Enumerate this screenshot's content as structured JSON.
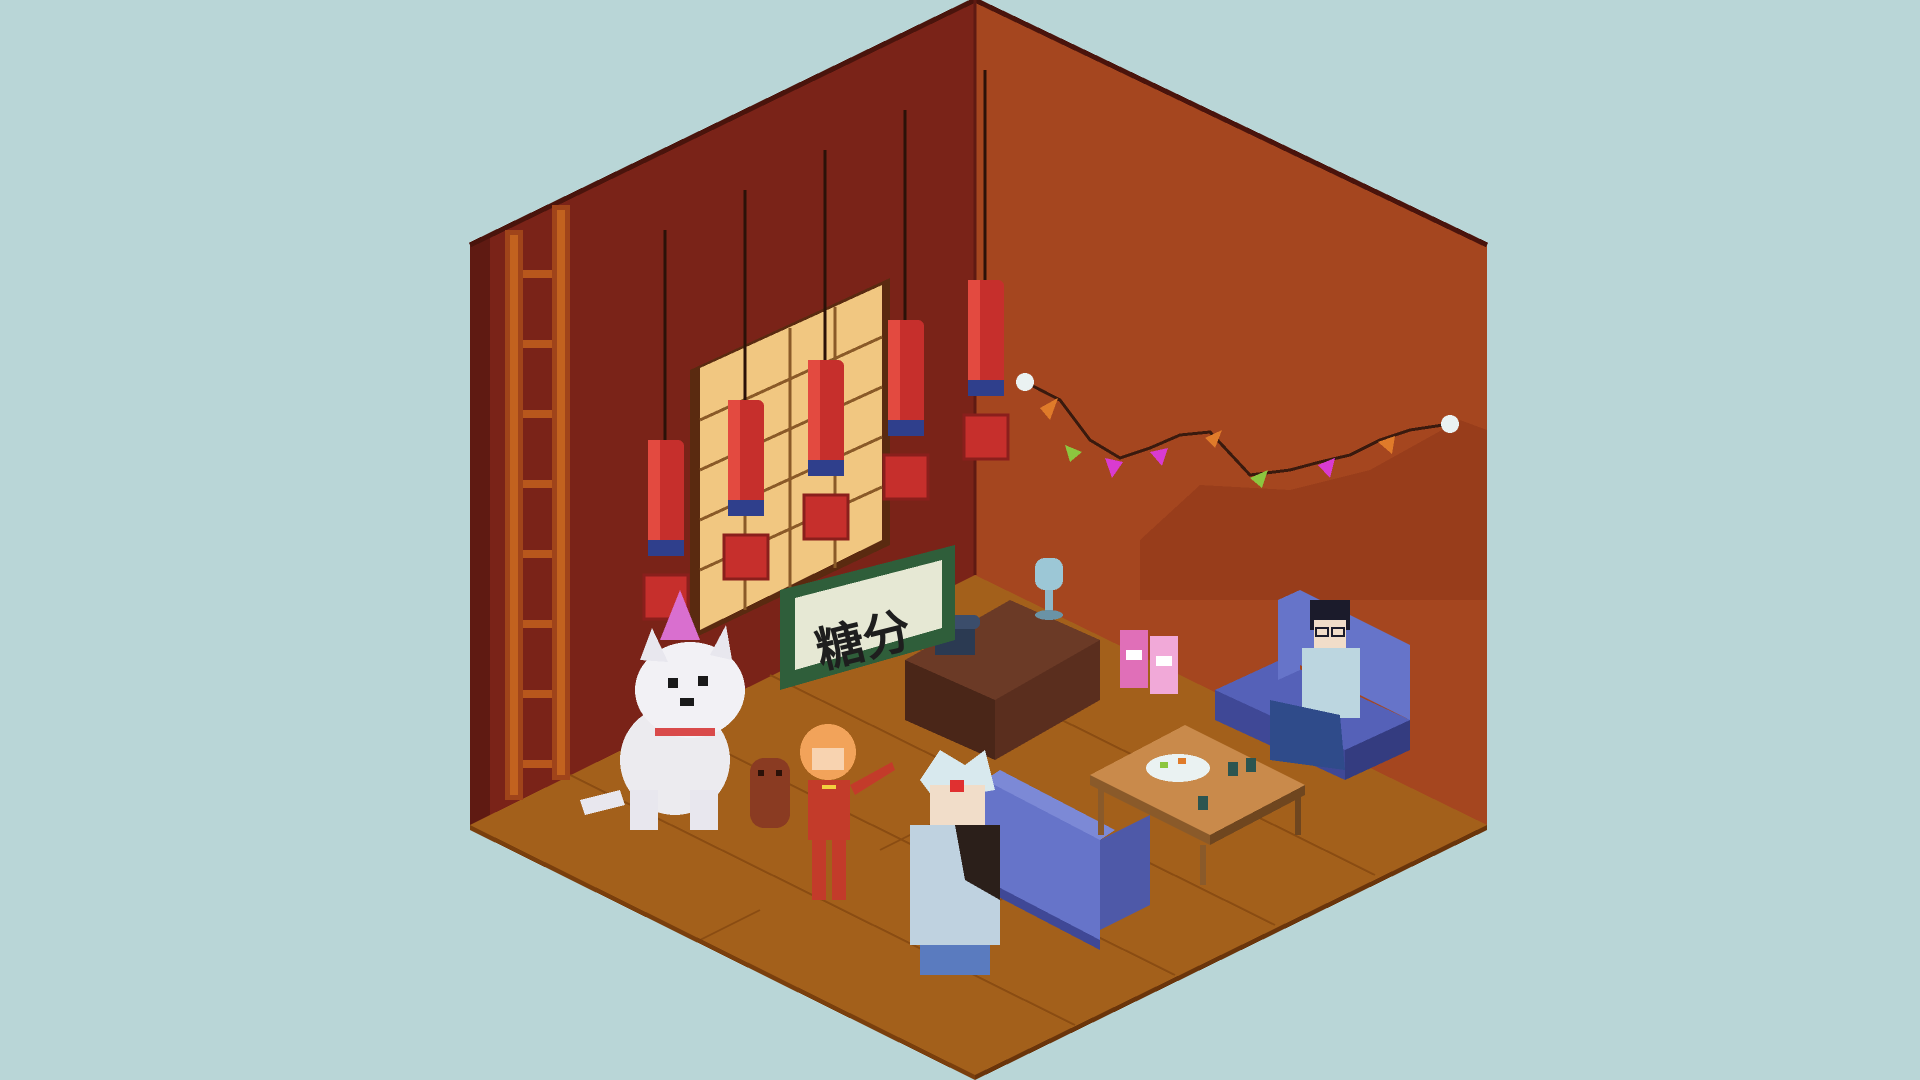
{
  "scene": {
    "type": "isometric pixel-art room diorama",
    "colors": {
      "background": "#b9d6d7",
      "wall_left": "#7a2318",
      "wall_right": "#a5461f",
      "floor": "#a3601b",
      "lantern_red": "#c62f2c",
      "lantern_blue": "#2f3f8c",
      "sofa_blue": "#6674c9",
      "desk_wood": "#5a2e1e",
      "sign_green": "#2f5e3a"
    },
    "sign": {
      "text": "糖分"
    },
    "lanterns": [
      {
        "id": 1
      },
      {
        "id": 2
      },
      {
        "id": 3
      },
      {
        "id": 4
      },
      {
        "id": 5
      }
    ],
    "bunting_flags": [
      {
        "color": "#e07b2a"
      },
      {
        "color": "#8cc63f"
      },
      {
        "color": "#d93bd0"
      },
      {
        "color": "#d93bd0"
      },
      {
        "color": "#e07b2a"
      },
      {
        "color": "#8cc63f"
      },
      {
        "color": "#d93bd0"
      },
      {
        "color": "#e07b2a"
      }
    ],
    "characters": [
      {
        "name": "white-dog",
        "icon": "dog-with-party-hat"
      },
      {
        "name": "girl-red-qipao",
        "icon": "girl"
      },
      {
        "name": "silver-haired-man",
        "icon": "man-silver-hair"
      },
      {
        "name": "boy-with-glasses",
        "icon": "boy-glasses"
      }
    ]
  }
}
